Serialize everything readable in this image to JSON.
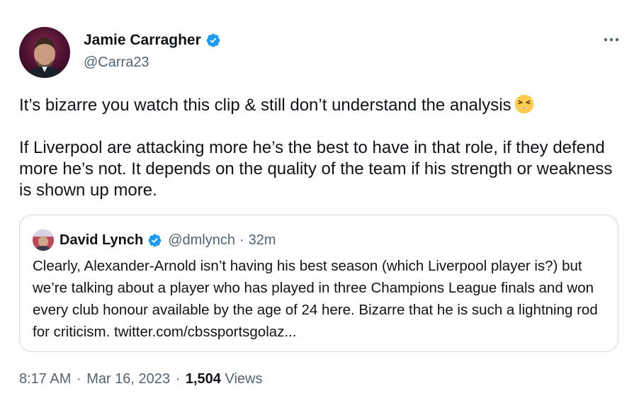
{
  "author": {
    "name": "Jamie Carragher",
    "handle": "@Carra23",
    "verified": true
  },
  "tweet": {
    "paragraph1": "It’s bizarre you watch this clip & still don’t understand the analysis",
    "paragraph1_emoji": "tired-face-emoji",
    "paragraph2": "If Liverpool are attacking more he’s the best to have in that role, if they defend more he’s not. It depends on the quality of the team if his strength or weakness is shown up more."
  },
  "quoted_tweet": {
    "name": "David Lynch",
    "handle": "@dmlynch",
    "separator": "·",
    "time": "32m",
    "verified": true,
    "text": "Clearly, Alexander-Arnold isn’t having his best season (which Liverpool player is?) but we’re talking about a player who has played in three Champions League finals and won every club honour available by the age of 24 here. Bizarre that he is such a lightning rod for criticism. twitter.com/cbssportsgolaz..."
  },
  "footer": {
    "time": "8:17 AM",
    "sep1": "·",
    "date": "Mar 16, 2023",
    "sep2": "·",
    "views_count": "1,504",
    "views_label": "Views"
  },
  "icons": {
    "verified_badge": "verified-badge-icon",
    "more": "more-options-icon"
  },
  "colors": {
    "verified_blue": "#1d9bf0",
    "secondary_text": "#536471",
    "primary_text": "#0f1419",
    "border": "#cfd9de"
  }
}
